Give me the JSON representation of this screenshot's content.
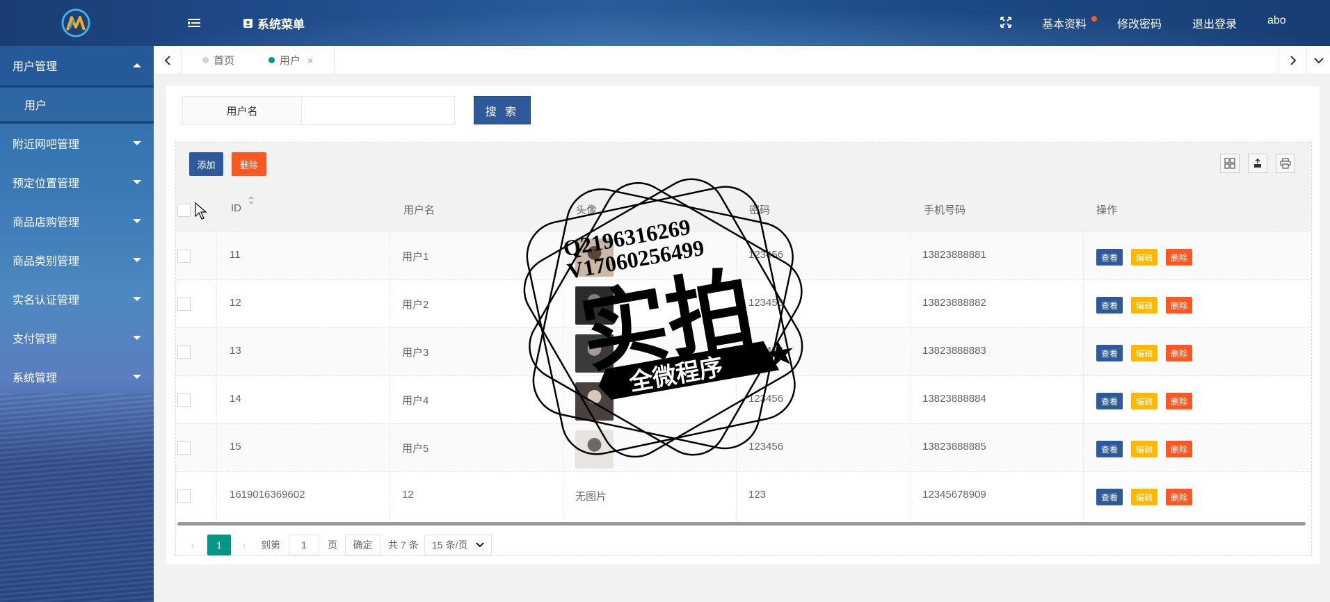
{
  "header": {
    "system_menu": "系统菜单",
    "links": {
      "profile": "基本资料",
      "change_password": "修改密码",
      "logout": "退出登录",
      "user": "abo"
    }
  },
  "sidebar": {
    "items": [
      {
        "label": "用户管理",
        "expanded": true,
        "children": [
          "用户"
        ]
      },
      {
        "label": "附近网吧管理"
      },
      {
        "label": "预定位置管理"
      },
      {
        "label": "商品店购管理"
      },
      {
        "label": "商品类别管理"
      },
      {
        "label": "实名认证管理"
      },
      {
        "label": "支付管理"
      },
      {
        "label": "系统管理"
      }
    ]
  },
  "tabs": [
    {
      "label": "首页",
      "active": false
    },
    {
      "label": "用户",
      "active": true,
      "close": "×"
    }
  ],
  "search": {
    "label": "用户名",
    "placeholder": "",
    "button": "搜 索"
  },
  "toolbar": {
    "add": "添加",
    "delete": "删除"
  },
  "table": {
    "columns": [
      "ID",
      "用户名",
      "头像",
      "密码",
      "手机号码",
      "操作"
    ],
    "rows": [
      {
        "id": "11",
        "username": "用户1",
        "avatar": "",
        "password": "123456",
        "phone": "13823888881"
      },
      {
        "id": "12",
        "username": "用户2",
        "avatar": "",
        "password": "123456",
        "phone": "13823888882"
      },
      {
        "id": "13",
        "username": "用户3",
        "avatar": "",
        "password": "123456",
        "phone": "13823888883"
      },
      {
        "id": "14",
        "username": "用户4",
        "avatar": "",
        "password": "123456",
        "phone": "13823888884"
      },
      {
        "id": "15",
        "username": "用户5",
        "avatar": "",
        "password": "123456",
        "phone": "13823888885"
      },
      {
        "id": "1619016369602",
        "username": "12",
        "avatar": "无图片",
        "password": "123",
        "phone": "12345678909"
      }
    ],
    "actions": {
      "view": "查看",
      "edit": "编辑",
      "delete": "删除"
    }
  },
  "pagination": {
    "current": "1",
    "goto_label": "到第",
    "goto_value": "1",
    "page_suffix": "页",
    "confirm": "确定",
    "total": "共 7 条",
    "page_size": "15 条/页"
  },
  "watermark": {
    "line1": "Q2196316269",
    "line2": "V17060256499",
    "main": "实拍",
    "ribbon": "全微程序"
  },
  "colors": {
    "primary": "#2e5a9c",
    "danger": "#ff5722",
    "warning": "#ffb800",
    "teal": "#009688"
  }
}
